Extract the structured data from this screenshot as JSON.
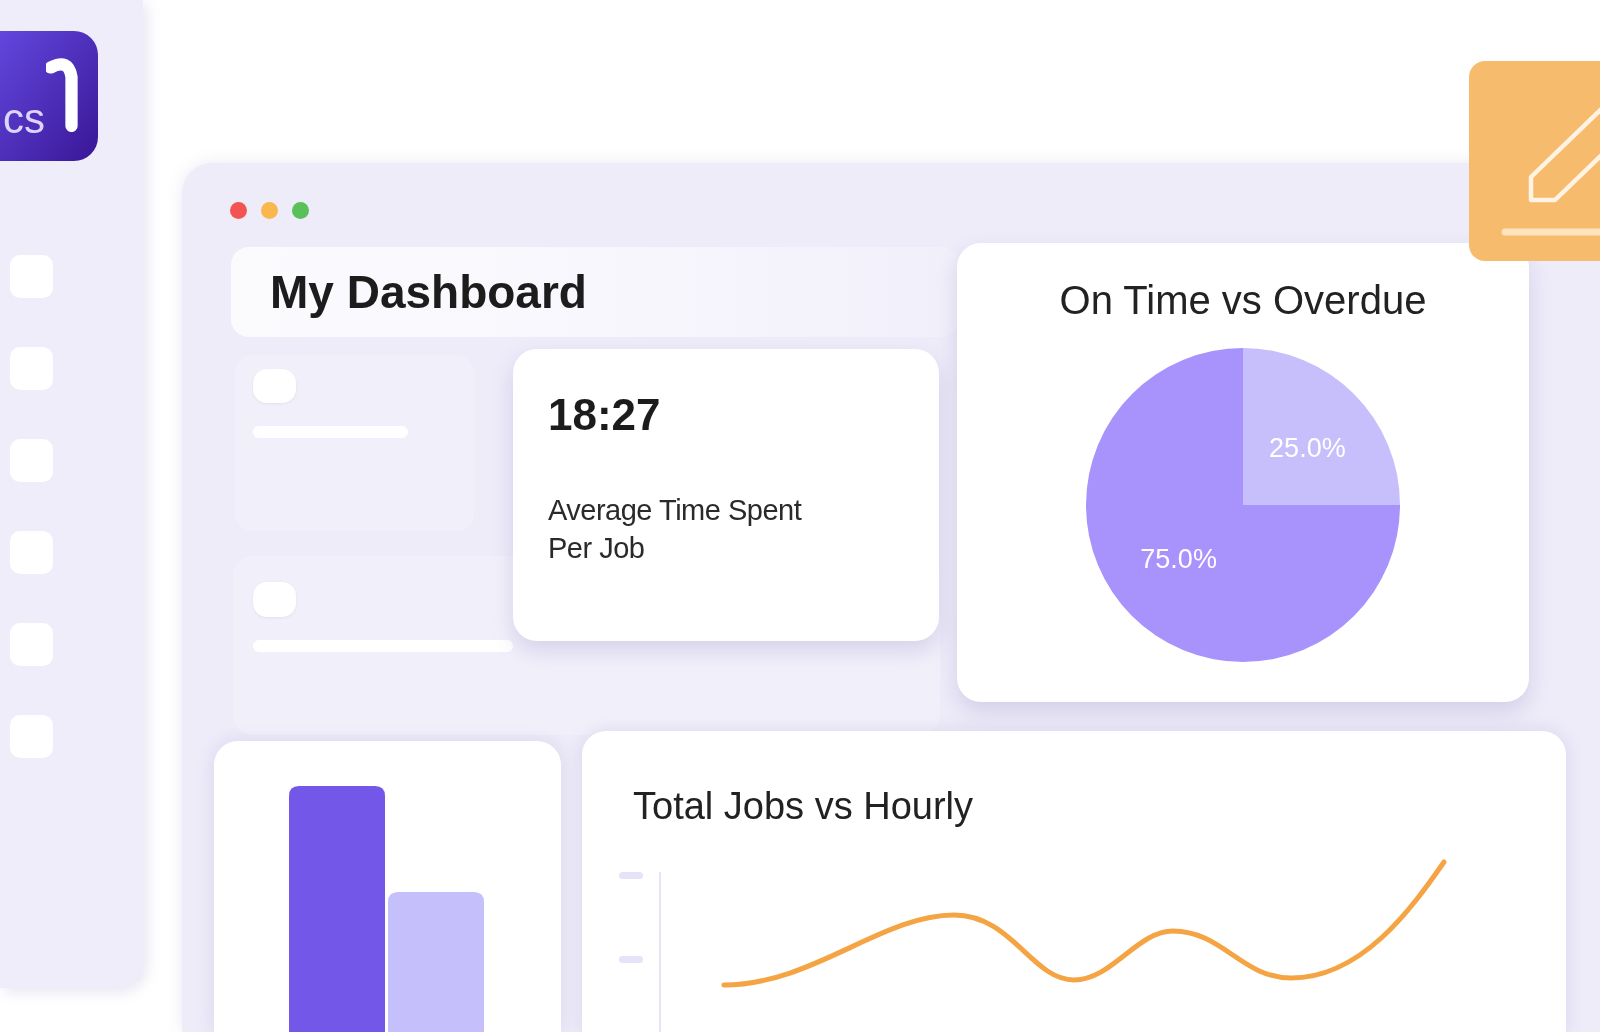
{
  "sidebar": {
    "logo_text": "cs"
  },
  "window": {
    "title": "My Dashboard"
  },
  "stat_card": {
    "value": "18:27",
    "label": "Average Time Spent Per Job"
  },
  "pie_card": {
    "chart_data": [
      {
        "type": "pie",
        "title": "On Time vs Overdue",
        "categories": [
          null,
          null
        ],
        "values": [
          25,
          75
        ],
        "colors": [
          "#c6bffc",
          "#a893fd"
        ],
        "value_labels": [
          "25.0%",
          "75.0%"
        ]
      }
    ]
  },
  "line_card": {
    "title": "Total Jobs vs Hourly"
  }
}
